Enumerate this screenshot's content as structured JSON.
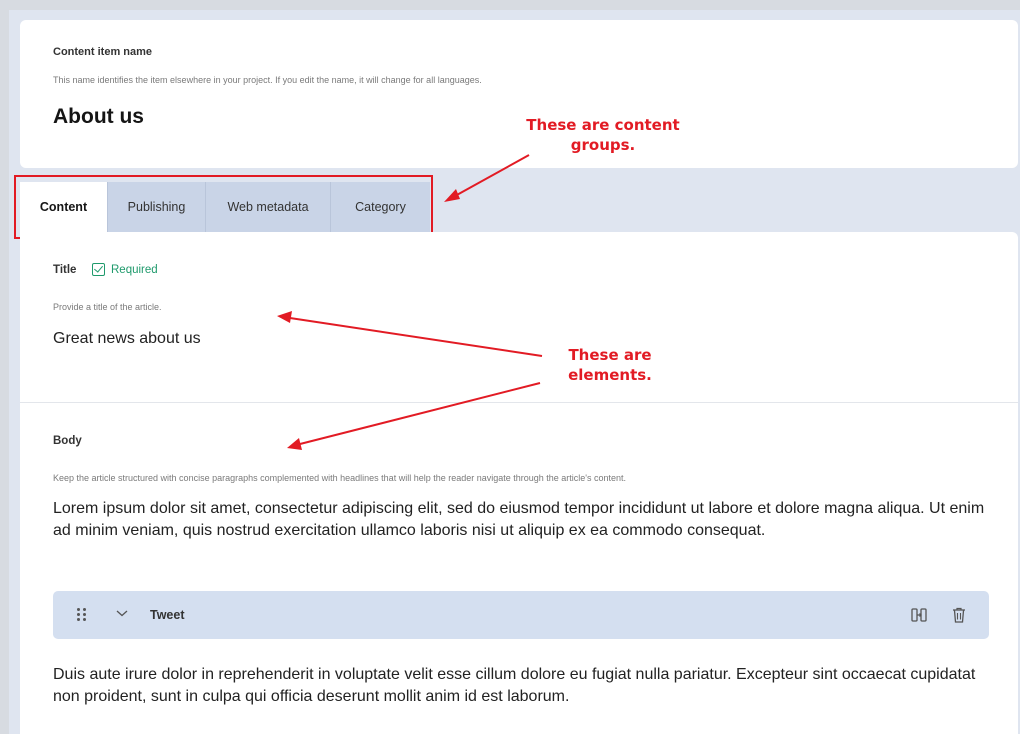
{
  "content_item": {
    "name_label": "Content item name",
    "name_help": "This name identifies the item elsewhere in your project. If you edit the name, it will change for all languages.",
    "name_value": "About us"
  },
  "tabs": [
    {
      "label": "Content",
      "active": true
    },
    {
      "label": "Publishing",
      "active": false
    },
    {
      "label": "Web metadata",
      "active": false
    },
    {
      "label": "Category",
      "active": false
    }
  ],
  "title_element": {
    "label": "Title",
    "required_label": "Required",
    "help": "Provide a title of the article.",
    "value": "Great news about us"
  },
  "body_element": {
    "label": "Body",
    "help": "Keep the article structured with concise paragraphs complemented with headlines that will help the reader navigate through the article's content.",
    "paragraph_1": "Lorem ipsum dolor sit amet, consectetur adipiscing elit, sed do eiusmod tempor incididunt ut labore et dolore magna aliqua. Ut enim ad minim veniam, quis nostrud exercitation ullamco laboris nisi ut aliquip ex ea commodo consequat.",
    "component": {
      "label": "Tweet",
      "icons": [
        "drag-handle-icon",
        "chevron-down-icon",
        "convert-icon",
        "trash-icon"
      ]
    },
    "paragraph_2": "Duis aute irure dolor in reprehenderit in voluptate velit esse cillum dolore eu fugiat nulla pariatur. Excepteur sint occaecat cupidatat non proident, sunt in culpa qui officia deserunt mollit anim id est laborum."
  },
  "annotations": {
    "groups": "These are content groups.",
    "elements": "These are elements."
  },
  "colors": {
    "annotation": "#e21b24",
    "required": "#1f9a6c",
    "tab_inactive": "#c9d4e7",
    "component_background": "#d4dff0",
    "workspace": "#dfe5f0"
  }
}
